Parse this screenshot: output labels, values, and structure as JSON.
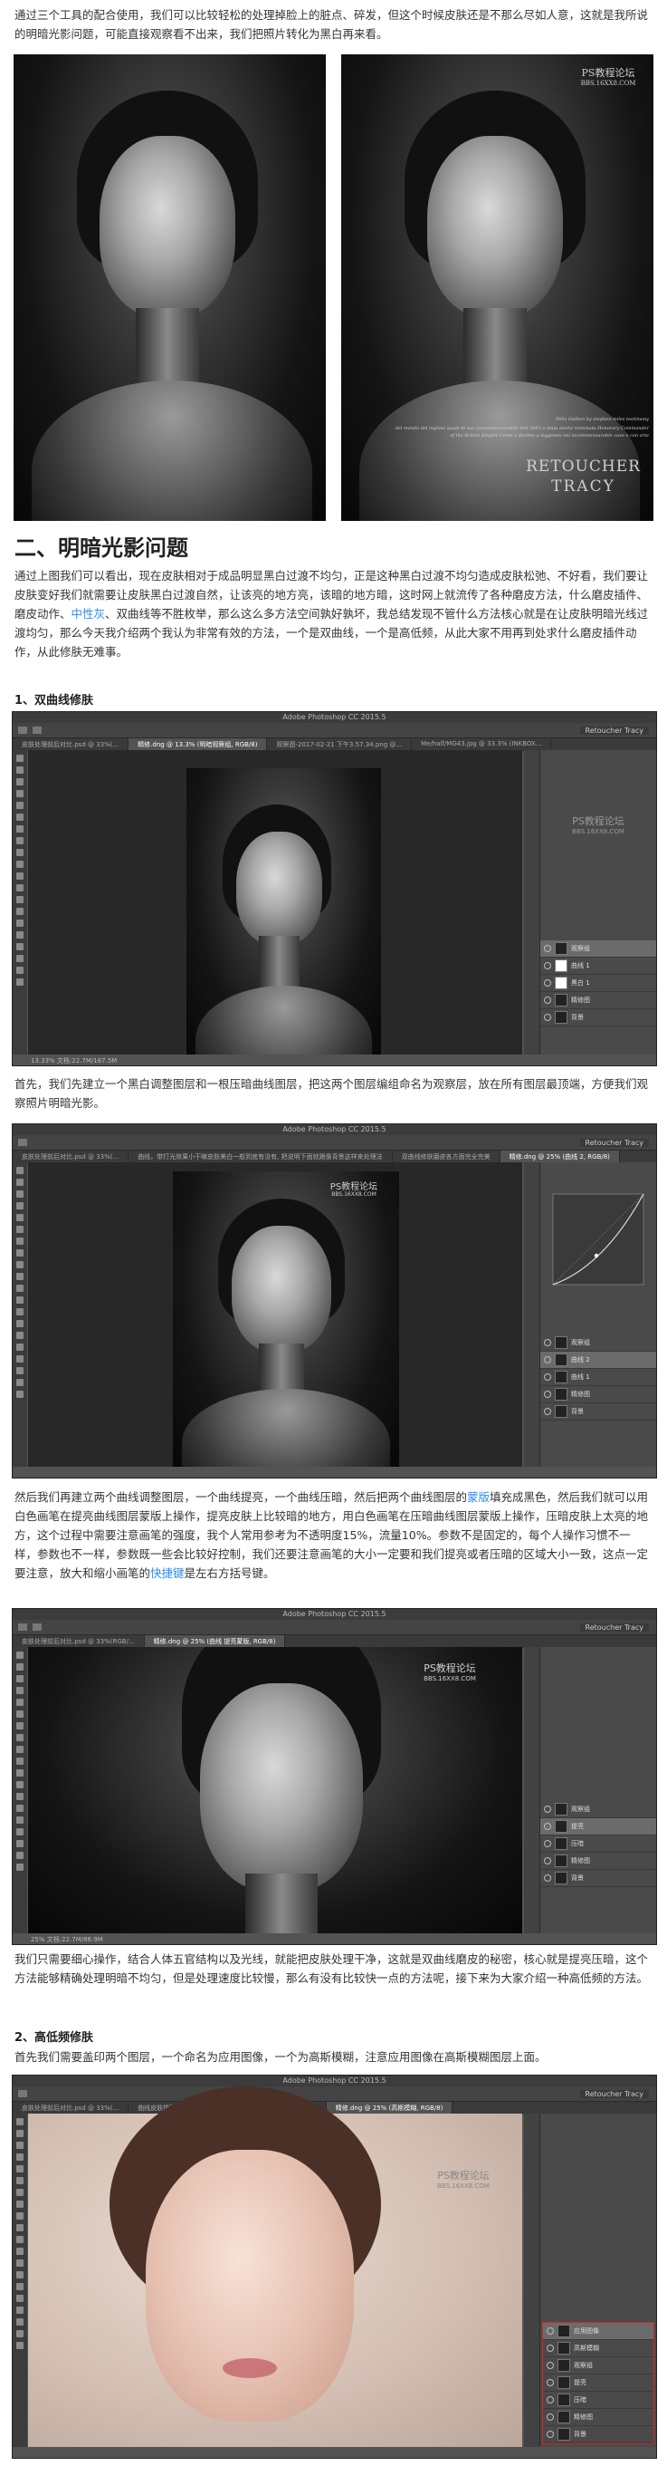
{
  "intro": {
    "text": "通过三个工具的配合使用，我们可以比较轻松的处理掉脸上的脏点、碎发，但这个时候皮肤还是不那么尽如人意，这就是我所说的明暗光影问题，可能直接观察看不出来，我们把照片转化为黑白再来看。"
  },
  "photo_right": {
    "watermark_cn": "PS教程论坛",
    "watermark_en": "BBS.16XX8.COM",
    "signature_small": "Felix Gullien by stephen miles testimony",
    "caption_line1": "del mondo del inglese quale di suo incommensurabile Nel 2003 e stata anche nominata Honorary Commander",
    "caption_line2": "of the British Empire Come a decimo a leggendo nei incommensurable cave e con arte",
    "brand_line1": "RETOUCHER",
    "brand_line2": "TRACY"
  },
  "section2": {
    "heading": "二、明暗光影问题",
    "para": "通过上图我们可以看出，现在皮肤相对于成品明显黑白过渡不均匀，正是这种黑白过渡不均匀造成皮肤松弛、不好看，我们要让皮肤变好我们就需要让皮肤黑白过渡自然，让该亮的地方亮，该暗的地方暗，这时网上就流传了各种磨皮方法，什么磨皮插件、磨皮动作、",
    "para_link": "中性灰",
    "para_rest": "、双曲线等不胜枚举，那么这么多方法空间孰好孰坏，我总结发现不管什么方法核心就是在让皮肤明暗光线过渡均匀，那么今天我介绍两个我认为非常有效的方法，一个是双曲线，一个是高低频，从此大家不用再到处求什么磨皮插件动作，从此修肤无难事。"
  },
  "sub1": {
    "heading": "1、双曲线修肤"
  },
  "ps1": {
    "title": "Adobe Photoshop CC 2015.5",
    "user": "Retoucher Tracy",
    "tabs": [
      "皮肤处理前后对比.psd @ 33%(...",
      "精修.dng @ 13.3% (明暗观察组, RGB/8)",
      "观察图-2017-02-21 下午3.57.34.png @...",
      "Me/half/MG43.jpg @ 33.3% (INKBOX..."
    ],
    "watermark": "PS教程论坛",
    "watermark_sub": "BBS.16XX8.COM",
    "status": "13.33%  文档:22.7M/167.5M",
    "layers": [
      "观察组",
      "曲线 1",
      "黑白 1",
      "精修图",
      "背景"
    ]
  },
  "p_after1": {
    "text": "首先，我们先建立一个黑白调整图层和一根压暗曲线图层，把这两个图层编组命名为观察层，放在所有图层最顶端，方便我们观察照片明暗光影。"
  },
  "ps2": {
    "title": "Adobe Photoshop CC 2015.5",
    "user": "Retoucher Tracy",
    "tabs": [
      "皮肤处理前后对比.psd @ 33%(...",
      "曲线，带打光效果小干嘛皮肤美白一般到底有没有, 把说明下面就跟像背景这样来处理法",
      "双曲线修肤磨皮各方面完全完美",
      "精修.dng @ 25% (曲线 2, RGB/8)"
    ],
    "watermark": "PS教程论坛",
    "watermark_sub": "BBS.16XX8.COM",
    "layers": [
      "观察组",
      "曲线 2",
      "曲线 1",
      "精修图",
      "背景"
    ]
  },
  "p_after2": {
    "pre": "然后我们再建立两个曲线调整图层，一个曲线提亮，一个曲线压暗，然后把两个曲线图层的",
    "link1": "蒙版",
    "mid": "填充成黑色，然后我们就可以用白色画笔在提亮曲线图层蒙版上操作，提亮皮肤上比较暗的地方，用白色画笔在压暗曲线图层蒙版上操作，压暗皮肤上太亮的地方，这个过程中需要注意画笔的强度，我个人常用参考为不透明度15%，流量10%。参数不是固定的，每个人操作习惯不一样，参数也不一样，参数既一些会比较好控制，我们还要注意画笔的大小一定要和我们提亮或者压暗的区域大小一致，这点一定要注意，放大和缩小画笔的",
    "link2": "快捷键",
    "post": "是左右方括号键。"
  },
  "ps3": {
    "title": "Adobe Photoshop CC 2015.5",
    "user": "Retoucher Tracy",
    "tabs": [
      "皮肤处理前后对比.psd @ 33%(RGB/...",
      "精修.dng @ 25% (曲线 提亮蒙版, RGB/8)"
    ],
    "watermark": "PS教程论坛",
    "watermark_sub": "BBS.16XX8.COM",
    "status": "25%  文档:22.7M/86.9M",
    "layers": [
      "观察组",
      "提亮",
      "压暗",
      "精修图",
      "背景"
    ]
  },
  "p_after3": {
    "text": "我们只需要细心操作，结合人体五官结构以及光线，就能把皮肤处理干净，这就是双曲线磨皮的秘密，核心就是提亮压暗，这个方法能够精确处理明暗不均匀，但是处理速度比较慢，那么有没有比较快一点的方法呢，接下来为大家介绍一种高低频的方法。"
  },
  "sub2": {
    "heading": "2、高低频修肤"
  },
  "p_sub2": {
    "text": "首先我们需要盖印两个图层，一个命名为应用图像，一个为高斯模糊，注意应用图像在高斯模糊图层上面。"
  },
  "ps4": {
    "title": "Adobe Photoshop CC 2015.5",
    "user": "Retoucher Tracy",
    "tabs": [
      "皮肤处理前后对比.psd @ 33%(...",
      "曲线皮肤提亮暗部, 皮肤只有提亮和压暗整个, 注意我们在这里...",
      "精修.dng @ 25% (高斯模糊, RGB/8)"
    ],
    "watermark": "PS教程论坛",
    "watermark_sub": "BBS.16XX8.COM",
    "layers": [
      "应用图像",
      "高斯模糊",
      "观察组",
      "提亮",
      "压暗",
      "精修图",
      "背景"
    ]
  }
}
